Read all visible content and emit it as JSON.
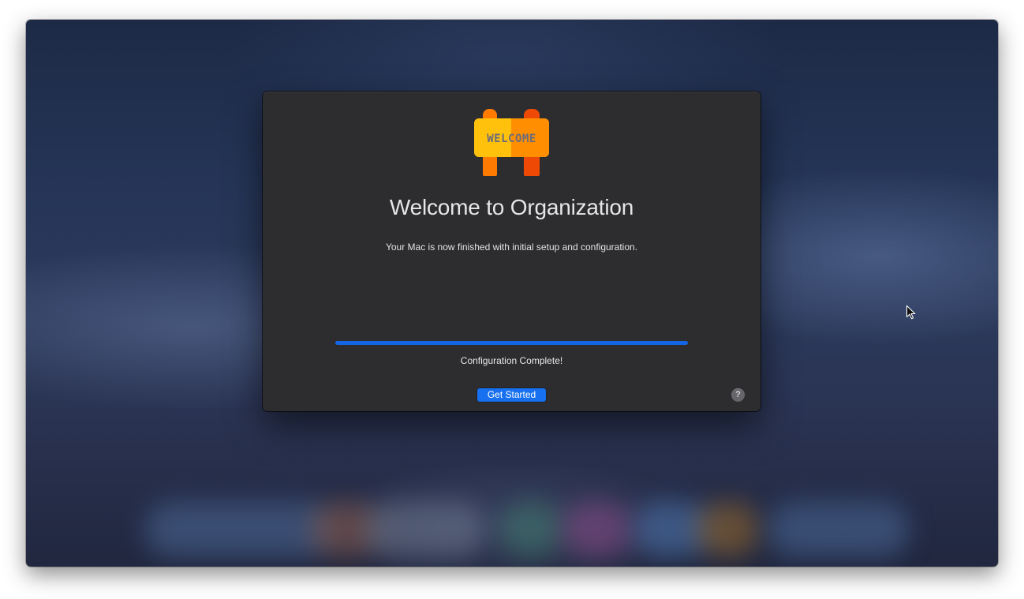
{
  "dialog": {
    "logo_text": "WELCOME",
    "title": "Welcome to Organization",
    "subtitle": "Your Mac is now finished with initial setup and configuration.",
    "progress": 1.0,
    "status": "Configuration Complete!",
    "primary_button": "Get Started",
    "help_glyph": "?"
  },
  "icons": {
    "logo": "welcome-sign-icon",
    "help": "help-icon",
    "cursor": "mouse-pointer-icon"
  },
  "colors": {
    "window_bg": "#2d2d30",
    "accent": "#1770ef",
    "progress_fill": "#1466e6",
    "sign_yellow": "#ffc10c",
    "sign_orange": "#ff8f00",
    "post_orange": "#ff7a00",
    "post_red": "#ee4a06"
  }
}
